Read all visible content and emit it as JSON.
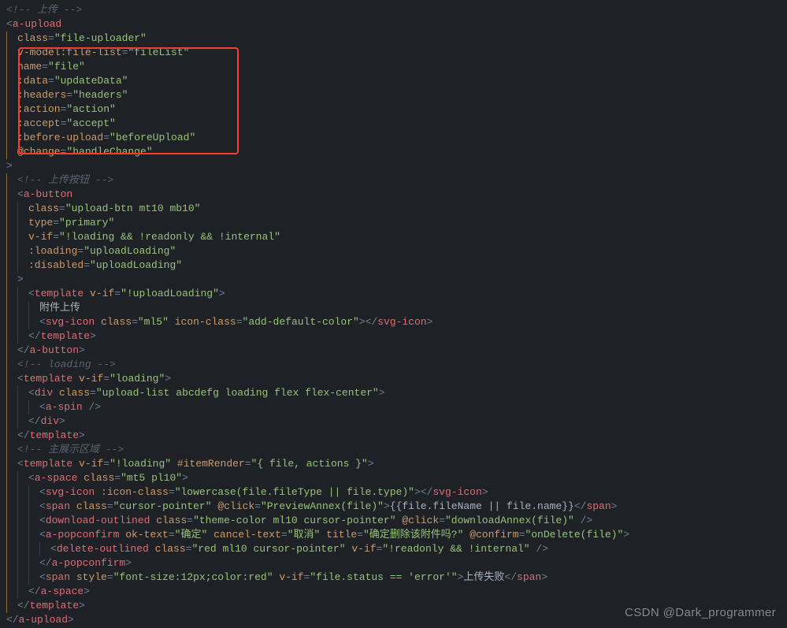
{
  "watermark": "CSDN @Dark_programmer",
  "lines": [
    {
      "i": 0,
      "spans": [
        {
          "c": "cm",
          "t": "<!-- 上传 -->"
        }
      ]
    },
    {
      "i": 0,
      "spans": [
        {
          "c": "pu",
          "t": "<"
        },
        {
          "c": "tg",
          "t": "a-upload"
        }
      ]
    },
    {
      "i": 1,
      "spans": [
        {
          "c": "at",
          "t": "class"
        },
        {
          "c": "pu",
          "t": "="
        },
        {
          "c": "st",
          "t": "\"file-uploader\""
        }
      ]
    },
    {
      "i": 1,
      "spans": [
        {
          "c": "at",
          "t": "v-model:file-list"
        },
        {
          "c": "pu",
          "t": "="
        },
        {
          "c": "st",
          "t": "\"fileList\""
        }
      ]
    },
    {
      "i": 1,
      "spans": [
        {
          "c": "at",
          "t": "name"
        },
        {
          "c": "pu",
          "t": "="
        },
        {
          "c": "st",
          "t": "\"file\""
        }
      ]
    },
    {
      "i": 1,
      "spans": [
        {
          "c": "at",
          "t": ":data"
        },
        {
          "c": "pu",
          "t": "="
        },
        {
          "c": "st",
          "t": "\"updateData\""
        }
      ]
    },
    {
      "i": 1,
      "spans": [
        {
          "c": "at",
          "t": ":headers"
        },
        {
          "c": "pu",
          "t": "="
        },
        {
          "c": "st",
          "t": "\"headers\""
        }
      ]
    },
    {
      "i": 1,
      "spans": [
        {
          "c": "at",
          "t": ":action"
        },
        {
          "c": "pu",
          "t": "="
        },
        {
          "c": "st",
          "t": "\"action\""
        }
      ]
    },
    {
      "i": 1,
      "spans": [
        {
          "c": "at",
          "t": ":accept"
        },
        {
          "c": "pu",
          "t": "="
        },
        {
          "c": "st",
          "t": "\"accept\""
        }
      ]
    },
    {
      "i": 1,
      "spans": [
        {
          "c": "at",
          "t": ":before-upload"
        },
        {
          "c": "pu",
          "t": "="
        },
        {
          "c": "st",
          "t": "\"beforeUpload\""
        }
      ]
    },
    {
      "i": 1,
      "spans": [
        {
          "c": "at",
          "t": "@change"
        },
        {
          "c": "pu",
          "t": "="
        },
        {
          "c": "st",
          "t": "\"handleChange\""
        }
      ]
    },
    {
      "i": 0,
      "spans": [
        {
          "c": "pu",
          "t": ">"
        }
      ]
    },
    {
      "i": 1,
      "spans": [
        {
          "c": "cm",
          "t": "<!-- 上传按钮 -->"
        }
      ]
    },
    {
      "i": 1,
      "spans": [
        {
          "c": "pu",
          "t": "<"
        },
        {
          "c": "tg",
          "t": "a-button"
        }
      ]
    },
    {
      "i": 2,
      "spans": [
        {
          "c": "at",
          "t": "class"
        },
        {
          "c": "pu",
          "t": "="
        },
        {
          "c": "st",
          "t": "\"upload-btn mt10 mb10\""
        }
      ]
    },
    {
      "i": 2,
      "spans": [
        {
          "c": "at",
          "t": "type"
        },
        {
          "c": "pu",
          "t": "="
        },
        {
          "c": "st",
          "t": "\"primary\""
        }
      ]
    },
    {
      "i": 2,
      "spans": [
        {
          "c": "at",
          "t": "v-if"
        },
        {
          "c": "pu",
          "t": "="
        },
        {
          "c": "st",
          "t": "\"!loading && !readonly && !internal\""
        }
      ]
    },
    {
      "i": 2,
      "spans": [
        {
          "c": "at",
          "t": ":loading"
        },
        {
          "c": "pu",
          "t": "="
        },
        {
          "c": "st",
          "t": "\"uploadLoading\""
        }
      ]
    },
    {
      "i": 2,
      "spans": [
        {
          "c": "at",
          "t": ":disabled"
        },
        {
          "c": "pu",
          "t": "="
        },
        {
          "c": "st",
          "t": "\"uploadLoading\""
        }
      ]
    },
    {
      "i": 1,
      "spans": [
        {
          "c": "pu",
          "t": ">"
        }
      ]
    },
    {
      "i": 2,
      "spans": [
        {
          "c": "pu",
          "t": "<"
        },
        {
          "c": "tg",
          "t": "template"
        },
        {
          "c": "tx",
          "t": " "
        },
        {
          "c": "at",
          "t": "v-if"
        },
        {
          "c": "pu",
          "t": "="
        },
        {
          "c": "st",
          "t": "\"!uploadLoading\""
        },
        {
          "c": "pu",
          "t": ">"
        }
      ]
    },
    {
      "i": 3,
      "spans": [
        {
          "c": "tx",
          "t": "附件上传"
        }
      ]
    },
    {
      "i": 3,
      "spans": [
        {
          "c": "pu",
          "t": "<"
        },
        {
          "c": "tg",
          "t": "svg-icon"
        },
        {
          "c": "tx",
          "t": " "
        },
        {
          "c": "at",
          "t": "class"
        },
        {
          "c": "pu",
          "t": "="
        },
        {
          "c": "st",
          "t": "\"ml5\""
        },
        {
          "c": "tx",
          "t": " "
        },
        {
          "c": "at",
          "t": "icon-class"
        },
        {
          "c": "pu",
          "t": "="
        },
        {
          "c": "st",
          "t": "\"add-default-color\""
        },
        {
          "c": "pu",
          "t": "></"
        },
        {
          "c": "tg",
          "t": "svg-icon"
        },
        {
          "c": "pu",
          "t": ">"
        }
      ]
    },
    {
      "i": 2,
      "spans": [
        {
          "c": "pu",
          "t": "</"
        },
        {
          "c": "tg",
          "t": "template"
        },
        {
          "c": "pu",
          "t": ">"
        }
      ]
    },
    {
      "i": 1,
      "spans": [
        {
          "c": "pu",
          "t": "</"
        },
        {
          "c": "tg",
          "t": "a-button"
        },
        {
          "c": "pu",
          "t": ">"
        }
      ]
    },
    {
      "i": 1,
      "spans": [
        {
          "c": "cm",
          "t": "<!-- loading -->"
        }
      ]
    },
    {
      "i": 1,
      "spans": [
        {
          "c": "pu",
          "t": "<"
        },
        {
          "c": "tg",
          "t": "template"
        },
        {
          "c": "tx",
          "t": " "
        },
        {
          "c": "at",
          "t": "v-if"
        },
        {
          "c": "pu",
          "t": "="
        },
        {
          "c": "st",
          "t": "\"loading\""
        },
        {
          "c": "pu",
          "t": ">"
        }
      ]
    },
    {
      "i": 2,
      "spans": [
        {
          "c": "pu",
          "t": "<"
        },
        {
          "c": "tg",
          "t": "div"
        },
        {
          "c": "tx",
          "t": " "
        },
        {
          "c": "at",
          "t": "class"
        },
        {
          "c": "pu",
          "t": "="
        },
        {
          "c": "st",
          "t": "\"upload-list abcdefg loading flex flex-center\""
        },
        {
          "c": "pu",
          "t": ">"
        }
      ]
    },
    {
      "i": 3,
      "spans": [
        {
          "c": "pu",
          "t": "<"
        },
        {
          "c": "tg",
          "t": "a-spin"
        },
        {
          "c": "tx",
          "t": " "
        },
        {
          "c": "pu",
          "t": "/>"
        }
      ]
    },
    {
      "i": 2,
      "spans": [
        {
          "c": "pu",
          "t": "</"
        },
        {
          "c": "tg",
          "t": "div"
        },
        {
          "c": "pu",
          "t": ">"
        }
      ]
    },
    {
      "i": 1,
      "spans": [
        {
          "c": "pu",
          "t": "</"
        },
        {
          "c": "tg",
          "t": "template"
        },
        {
          "c": "pu",
          "t": ">"
        }
      ]
    },
    {
      "i": 1,
      "spans": [
        {
          "c": "cm",
          "t": "<!-- 主展示区域 -->"
        }
      ]
    },
    {
      "i": 1,
      "spans": [
        {
          "c": "pu",
          "t": "<"
        },
        {
          "c": "tg",
          "t": "template"
        },
        {
          "c": "tx",
          "t": " "
        },
        {
          "c": "at",
          "t": "v-if"
        },
        {
          "c": "pu",
          "t": "="
        },
        {
          "c": "st",
          "t": "\"!loading\""
        },
        {
          "c": "tx",
          "t": " "
        },
        {
          "c": "at",
          "t": "#itemRender"
        },
        {
          "c": "pu",
          "t": "="
        },
        {
          "c": "st",
          "t": "\"{ file, actions }\""
        },
        {
          "c": "pu",
          "t": ">"
        }
      ]
    },
    {
      "i": 2,
      "spans": [
        {
          "c": "pu",
          "t": "<"
        },
        {
          "c": "tg",
          "t": "a-space"
        },
        {
          "c": "tx",
          "t": " "
        },
        {
          "c": "at",
          "t": "class"
        },
        {
          "c": "pu",
          "t": "="
        },
        {
          "c": "st",
          "t": "\"mt5 pl10\""
        },
        {
          "c": "pu",
          "t": ">"
        }
      ]
    },
    {
      "i": 3,
      "spans": [
        {
          "c": "pu",
          "t": "<"
        },
        {
          "c": "tg",
          "t": "svg-icon"
        },
        {
          "c": "tx",
          "t": " "
        },
        {
          "c": "at",
          "t": ":icon-class"
        },
        {
          "c": "pu",
          "t": "="
        },
        {
          "c": "st",
          "t": "\"lowercase(file.fileType || file.type)\""
        },
        {
          "c": "pu",
          "t": "></"
        },
        {
          "c": "tg",
          "t": "svg-icon"
        },
        {
          "c": "pu",
          "t": ">"
        }
      ]
    },
    {
      "i": 3,
      "spans": [
        {
          "c": "pu",
          "t": "<"
        },
        {
          "c": "tg",
          "t": "span"
        },
        {
          "c": "tx",
          "t": " "
        },
        {
          "c": "at",
          "t": "class"
        },
        {
          "c": "pu",
          "t": "="
        },
        {
          "c": "st",
          "t": "\"cursor-pointer\""
        },
        {
          "c": "tx",
          "t": " "
        },
        {
          "c": "at",
          "t": "@click"
        },
        {
          "c": "pu",
          "t": "="
        },
        {
          "c": "st",
          "t": "\"PreviewAnnex(file)\""
        },
        {
          "c": "pu",
          "t": ">"
        },
        {
          "c": "tx",
          "t": "{{file.fileName || file.name}}"
        },
        {
          "c": "pu",
          "t": "</"
        },
        {
          "c": "tg",
          "t": "span"
        },
        {
          "c": "pu",
          "t": ">"
        }
      ]
    },
    {
      "i": 3,
      "spans": [
        {
          "c": "pu",
          "t": "<"
        },
        {
          "c": "tg",
          "t": "download-outlined"
        },
        {
          "c": "tx",
          "t": " "
        },
        {
          "c": "at",
          "t": "class"
        },
        {
          "c": "pu",
          "t": "="
        },
        {
          "c": "st",
          "t": "\"theme-color ml10 cursor-pointer\""
        },
        {
          "c": "tx",
          "t": " "
        },
        {
          "c": "at",
          "t": "@click"
        },
        {
          "c": "pu",
          "t": "="
        },
        {
          "c": "st",
          "t": "\"downloadAnnex(file)\""
        },
        {
          "c": "tx",
          "t": " "
        },
        {
          "c": "pu",
          "t": "/>"
        }
      ]
    },
    {
      "i": 3,
      "spans": [
        {
          "c": "pu",
          "t": "<"
        },
        {
          "c": "tg",
          "t": "a-popconfirm"
        },
        {
          "c": "tx",
          "t": " "
        },
        {
          "c": "at",
          "t": "ok-text"
        },
        {
          "c": "pu",
          "t": "="
        },
        {
          "c": "st",
          "t": "\"确定\""
        },
        {
          "c": "tx",
          "t": " "
        },
        {
          "c": "at",
          "t": "cancel-text"
        },
        {
          "c": "pu",
          "t": "="
        },
        {
          "c": "st",
          "t": "\"取消\""
        },
        {
          "c": "tx",
          "t": " "
        },
        {
          "c": "at",
          "t": "title"
        },
        {
          "c": "pu",
          "t": "="
        },
        {
          "c": "st",
          "t": "\"确定删除该附件吗?\""
        },
        {
          "c": "tx",
          "t": " "
        },
        {
          "c": "at",
          "t": "@confirm"
        },
        {
          "c": "pu",
          "t": "="
        },
        {
          "c": "st",
          "t": "\"onDelete(file)\""
        },
        {
          "c": "pu",
          "t": ">"
        }
      ]
    },
    {
      "i": 4,
      "spans": [
        {
          "c": "pu",
          "t": "<"
        },
        {
          "c": "tg",
          "t": "delete-outlined"
        },
        {
          "c": "tx",
          "t": " "
        },
        {
          "c": "at",
          "t": "class"
        },
        {
          "c": "pu",
          "t": "="
        },
        {
          "c": "st",
          "t": "\"red ml10 cursor-pointer\""
        },
        {
          "c": "tx",
          "t": " "
        },
        {
          "c": "at",
          "t": "v-if"
        },
        {
          "c": "pu",
          "t": "="
        },
        {
          "c": "st",
          "t": "\"!readonly && !internal\""
        },
        {
          "c": "tx",
          "t": " "
        },
        {
          "c": "pu",
          "t": "/>"
        }
      ]
    },
    {
      "i": 3,
      "spans": [
        {
          "c": "pu",
          "t": "</"
        },
        {
          "c": "tg",
          "t": "a-popconfirm"
        },
        {
          "c": "pu",
          "t": ">"
        }
      ]
    },
    {
      "i": 3,
      "spans": [
        {
          "c": "pu",
          "t": "<"
        },
        {
          "c": "tg",
          "t": "span"
        },
        {
          "c": "tx",
          "t": " "
        },
        {
          "c": "at",
          "t": "style"
        },
        {
          "c": "pu",
          "t": "="
        },
        {
          "c": "st",
          "t": "\"font-size:12px;color:red\""
        },
        {
          "c": "tx",
          "t": " "
        },
        {
          "c": "at",
          "t": "v-if"
        },
        {
          "c": "pu",
          "t": "="
        },
        {
          "c": "st",
          "t": "\"file.status == 'error'\""
        },
        {
          "c": "pu",
          "t": ">"
        },
        {
          "c": "tx",
          "t": "上传失败"
        },
        {
          "c": "pu",
          "t": "</"
        },
        {
          "c": "tg",
          "t": "span"
        },
        {
          "c": "pu",
          "t": ">"
        }
      ]
    },
    {
      "i": 2,
      "spans": [
        {
          "c": "pu",
          "t": "</"
        },
        {
          "c": "tg",
          "t": "a-space"
        },
        {
          "c": "pu",
          "t": ">"
        }
      ]
    },
    {
      "i": 1,
      "spans": [
        {
          "c": "pu",
          "t": "</"
        },
        {
          "c": "tg",
          "t": "template"
        },
        {
          "c": "pu",
          "t": ">"
        }
      ]
    },
    {
      "i": 0,
      "spans": [
        {
          "c": "pu",
          "t": "</"
        },
        {
          "c": "tg",
          "t": "a-upload"
        },
        {
          "c": "pu",
          "t": ">"
        }
      ]
    }
  ]
}
